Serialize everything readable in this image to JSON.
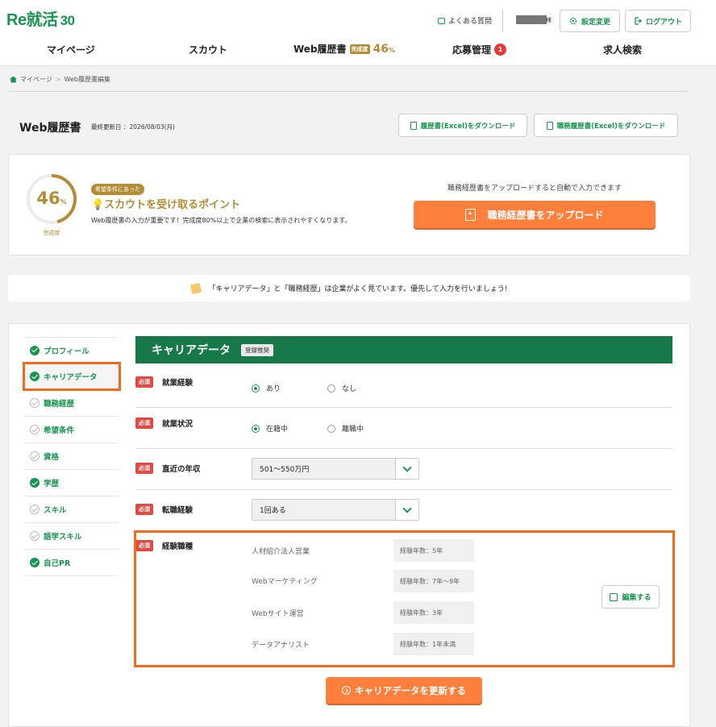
{
  "header": {
    "logo_main": "Re就活",
    "logo_num": "30",
    "faq_label": "よくある質問",
    "user_suffix": "様",
    "settings_label": "設定変更",
    "logout_label": "ログアウト"
  },
  "nav": {
    "mypage": "マイページ",
    "scout": "スカウト",
    "resume": "Web履歴書",
    "resume_badge": "完成度",
    "resume_pct": "46",
    "resume_pct_unit": "%",
    "apply": "応募管理",
    "apply_count": "1",
    "jobsearch": "求人検索"
  },
  "breadcrumb": {
    "home": "マイページ",
    "sep": ">",
    "current": "Web履歴書編集"
  },
  "page": {
    "title": "Web履歴書",
    "updated": "最終更新日 ：2026/08/03(月)",
    "download_resume": "履歴書(Excel)をダウンロード",
    "download_career": "職務履歴書(Excel)をダウンロード"
  },
  "progress": {
    "value": "46",
    "unit": "%",
    "fraction": 0.46,
    "label": "完成度",
    "pill": "希望条件にあった",
    "point_title": "💡スカウトを受け取るポイント",
    "point_desc": "Web履歴書の入力が重要です！完成度80%以上で企業の検索に表示されやすくなります。",
    "upload_hint": "職務経歴書をアップロードすると自動で入力できます",
    "upload_button": "職務経歴書をアップロード"
  },
  "notice": {
    "text": "「キャリアデータ」と「職務経歴」は企業がよく見ています。優先して入力を行いましょう!"
  },
  "sidebar": {
    "items": [
      {
        "label": "プロフィール",
        "done": true
      },
      {
        "label": "キャリアデータ",
        "done": true
      },
      {
        "label": "職務経歴",
        "done": false
      },
      {
        "label": "希望条件",
        "done": false
      },
      {
        "label": "資格",
        "done": false
      },
      {
        "label": "学歴",
        "done": true
      },
      {
        "label": "スキル",
        "done": false
      },
      {
        "label": "語学スキル",
        "done": false
      },
      {
        "label": "自己PR",
        "done": true
      }
    ]
  },
  "section": {
    "title": "キャリアデータ",
    "tag": "登録推奨",
    "required": "必須"
  },
  "form": {
    "employment": {
      "label": "就業経験",
      "opt1": "あり",
      "opt2": "なし",
      "selected": "あり"
    },
    "status": {
      "label": "就業状況",
      "opt1": "在籍中",
      "opt2": "離職中",
      "selected": "在籍中"
    },
    "income": {
      "label": "直近の年収",
      "value": "501～550万円"
    },
    "jobchange": {
      "label": "転職経験",
      "value": "1回ある"
    },
    "jobs": {
      "label": "経験職種",
      "items": [
        {
          "name": "人材紹介法人営業",
          "years": "経験年数：5年"
        },
        {
          "name": "Webマーケティング",
          "years": "経験年数：7年～9年"
        },
        {
          "name": "Webサイト運営",
          "years": "経験年数：3年"
        },
        {
          "name": "データアナリスト",
          "years": "経験年数：1年未満"
        }
      ],
      "edit_button": "編集する"
    },
    "submit_button": "キャリアデータを更新する"
  }
}
